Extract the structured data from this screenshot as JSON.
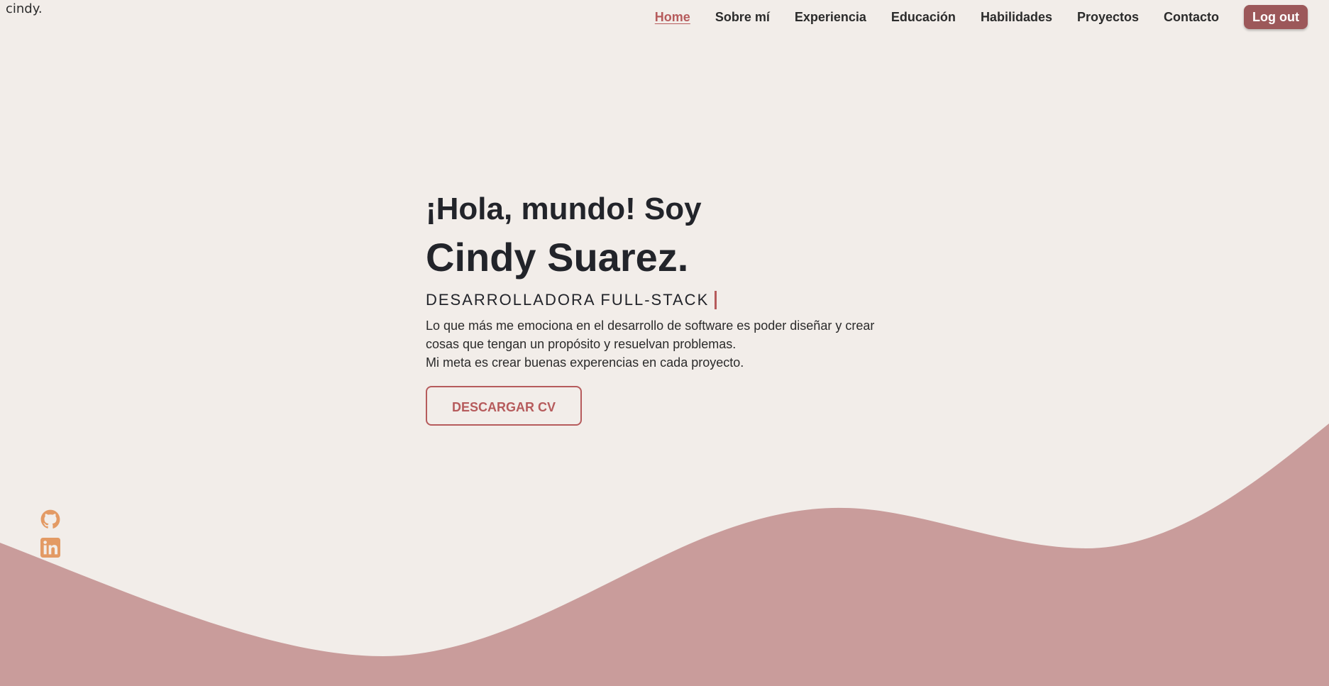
{
  "header": {
    "logo": "cindy.",
    "nav": [
      {
        "label": "Home",
        "active": true
      },
      {
        "label": "Sobre mí"
      },
      {
        "label": "Experiencia"
      },
      {
        "label": "Educación"
      },
      {
        "label": "Habilidades"
      },
      {
        "label": "Proyectos"
      },
      {
        "label": "Contacto"
      }
    ],
    "logout_label": "Log out"
  },
  "hero": {
    "greeting": "¡Hola, mundo! Soy",
    "name": "Cindy Suarez.",
    "role": "Desarrolladora Full-Stack",
    "description_1": "Lo que más me emociona en el desarrollo de software es poder diseñar y crear cosas que tengan un propósito y resuelvan problemas.",
    "description_2": "Mi meta es crear buenas experencias en cada proyecto.",
    "cv_button": "DESCARGAR CV"
  },
  "social": {
    "items": [
      {
        "icon": "github-icon"
      },
      {
        "icon": "linkedin-icon"
      }
    ]
  },
  "colors": {
    "background": "#f2ede9",
    "accent": "#b65b5c",
    "wave": "#c99c9b",
    "logout": "#9c585a",
    "social_icons": "#e39a64"
  }
}
